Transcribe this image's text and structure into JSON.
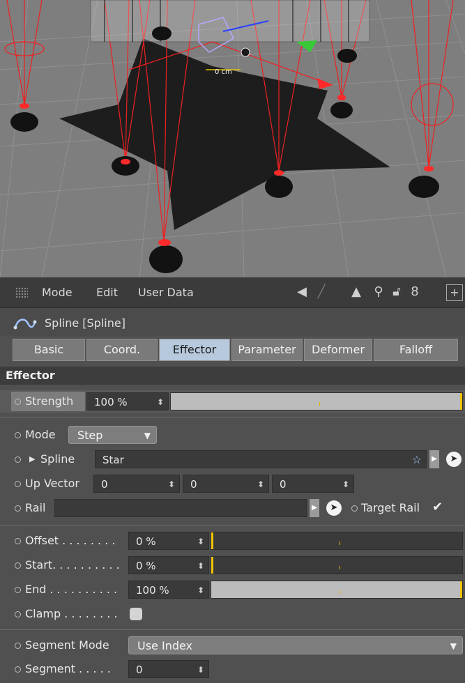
{
  "menu": {
    "mode": "Mode",
    "edit": "Edit",
    "user_data": "User Data"
  },
  "object": {
    "name": "Spline [Spline]"
  },
  "tabs": [
    "Basic",
    "Coord.",
    "Effector",
    "Parameter",
    "Deformer",
    "Falloff"
  ],
  "active_tab": "Effector",
  "section_title": "Effector",
  "viewport": {
    "readout": "0 cm"
  },
  "fields": {
    "strength": {
      "label": "Strength",
      "value": "100 %",
      "level_percent": 100
    },
    "mode": {
      "label": "Mode",
      "value": "Step"
    },
    "spline": {
      "label": "Spline",
      "value": "Star"
    },
    "up_vector": {
      "label": "Up Vector",
      "x": "0",
      "y": "0",
      "z": "0"
    },
    "rail": {
      "label": "Rail",
      "value": ""
    },
    "target_rail": {
      "label": "Target Rail",
      "checked": true
    },
    "offset": {
      "label": "Offset . . . . . . . .",
      "value": "0 %",
      "level_percent": 0
    },
    "start": {
      "label": "Start. . . . . . . . . .",
      "value": "0 %",
      "level_percent": 0
    },
    "end": {
      "label": "End . . . . . . . . . .",
      "value": "100 %",
      "level_percent": 100
    },
    "clamp": {
      "label": "Clamp . . . . . . . .",
      "checked": false
    },
    "segment_mode": {
      "label": "Segment Mode",
      "value": "Use Index"
    },
    "segment": {
      "label": "Segment . . . . .",
      "value": "0"
    }
  },
  "colors": {
    "accent": "#f2c200",
    "active_tab": "#b6c9dd",
    "panel_bg": "#505050",
    "viewport_bg": "#7d7d7d"
  }
}
